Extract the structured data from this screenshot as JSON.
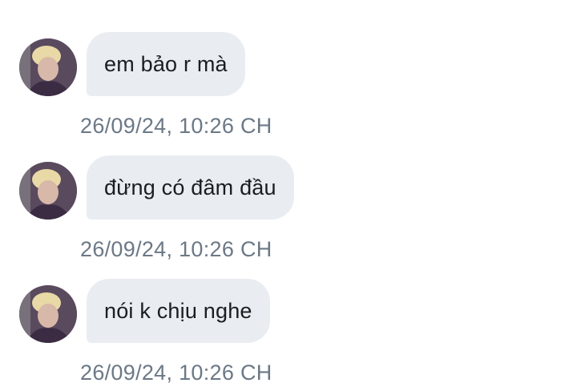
{
  "messages": [
    {
      "text": "em bảo r mà",
      "timestamp": "26/09/24, 10:26 CH"
    },
    {
      "text": "đừng có đâm đầu",
      "timestamp": "26/09/24, 10:26 CH"
    },
    {
      "text": "nói k chịu nghe",
      "timestamp": "26/09/24, 10:26 CH"
    }
  ],
  "colors": {
    "bubble_bg": "#e9edf1",
    "text": "#1a1d21",
    "timestamp": "#6b7886"
  },
  "icons": [
    "avatar"
  ]
}
